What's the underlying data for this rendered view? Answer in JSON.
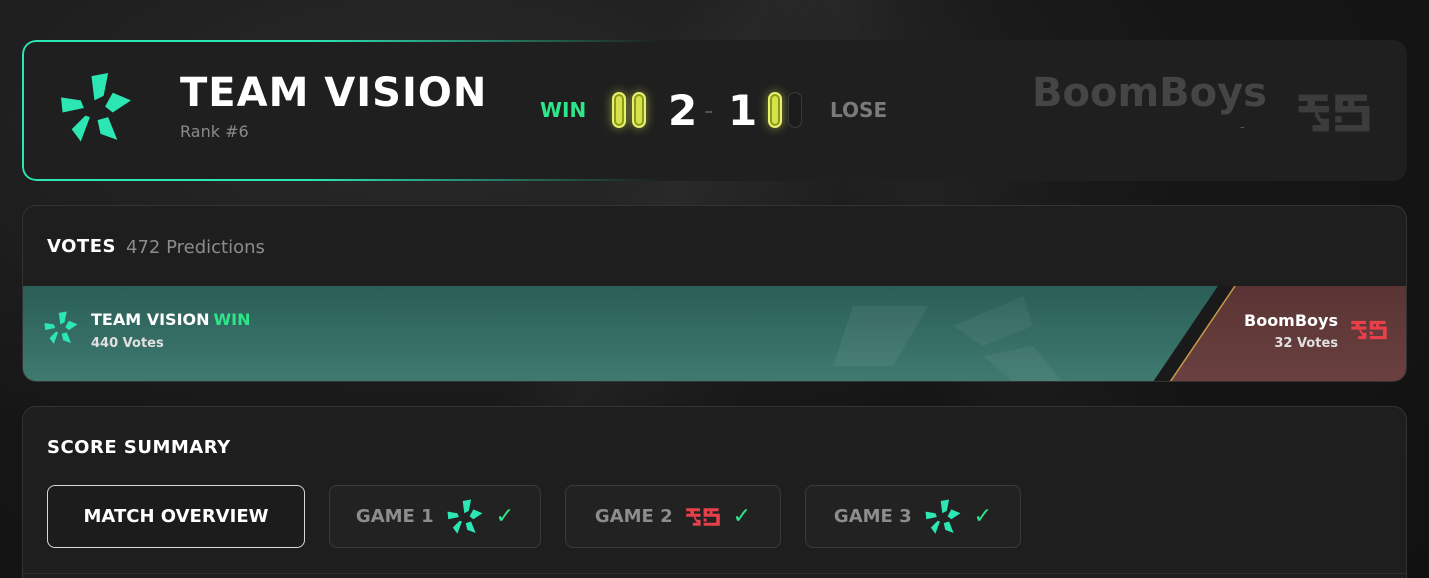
{
  "match": {
    "team": {
      "name": "TEAM VISION",
      "rank": "Rank #6",
      "result": "WIN",
      "score": "2"
    },
    "opponent": {
      "name": "BoomBoys",
      "rank": "-",
      "result": "LOSE",
      "score": "1"
    },
    "separator": "-",
    "team_pips": [
      true,
      true
    ],
    "opponent_pips": [
      true,
      false
    ]
  },
  "votes": {
    "title": "VOTES",
    "subtitle": "472 Predictions",
    "team": {
      "name": "TEAM VISION",
      "tag": "WIN",
      "count": "440 Votes",
      "share": 0.932
    },
    "opponent": {
      "name": "BoomBoys",
      "count": "32 Votes",
      "share": 0.068
    }
  },
  "summary": {
    "title": "SCORE SUMMARY",
    "tabs": [
      {
        "label": "MATCH OVERVIEW",
        "active": true
      },
      {
        "label": "GAME 1",
        "winner": "team-vision",
        "checked": true
      },
      {
        "label": "GAME 2",
        "winner": "boomboys",
        "checked": true
      },
      {
        "label": "GAME 3",
        "winner": "team-vision",
        "checked": true
      }
    ],
    "check_glyph": "✓"
  },
  "colors": {
    "accent_teal": "#2ce6b4",
    "win_green": "#2ee68a",
    "pip_yellow": "#d6e24a",
    "boomboys_red": "#e8404a"
  },
  "icons": {
    "team_logo": "team-vision-logo-icon",
    "opponent_logo": "boomboys-logo-icon",
    "check": "check-icon"
  }
}
